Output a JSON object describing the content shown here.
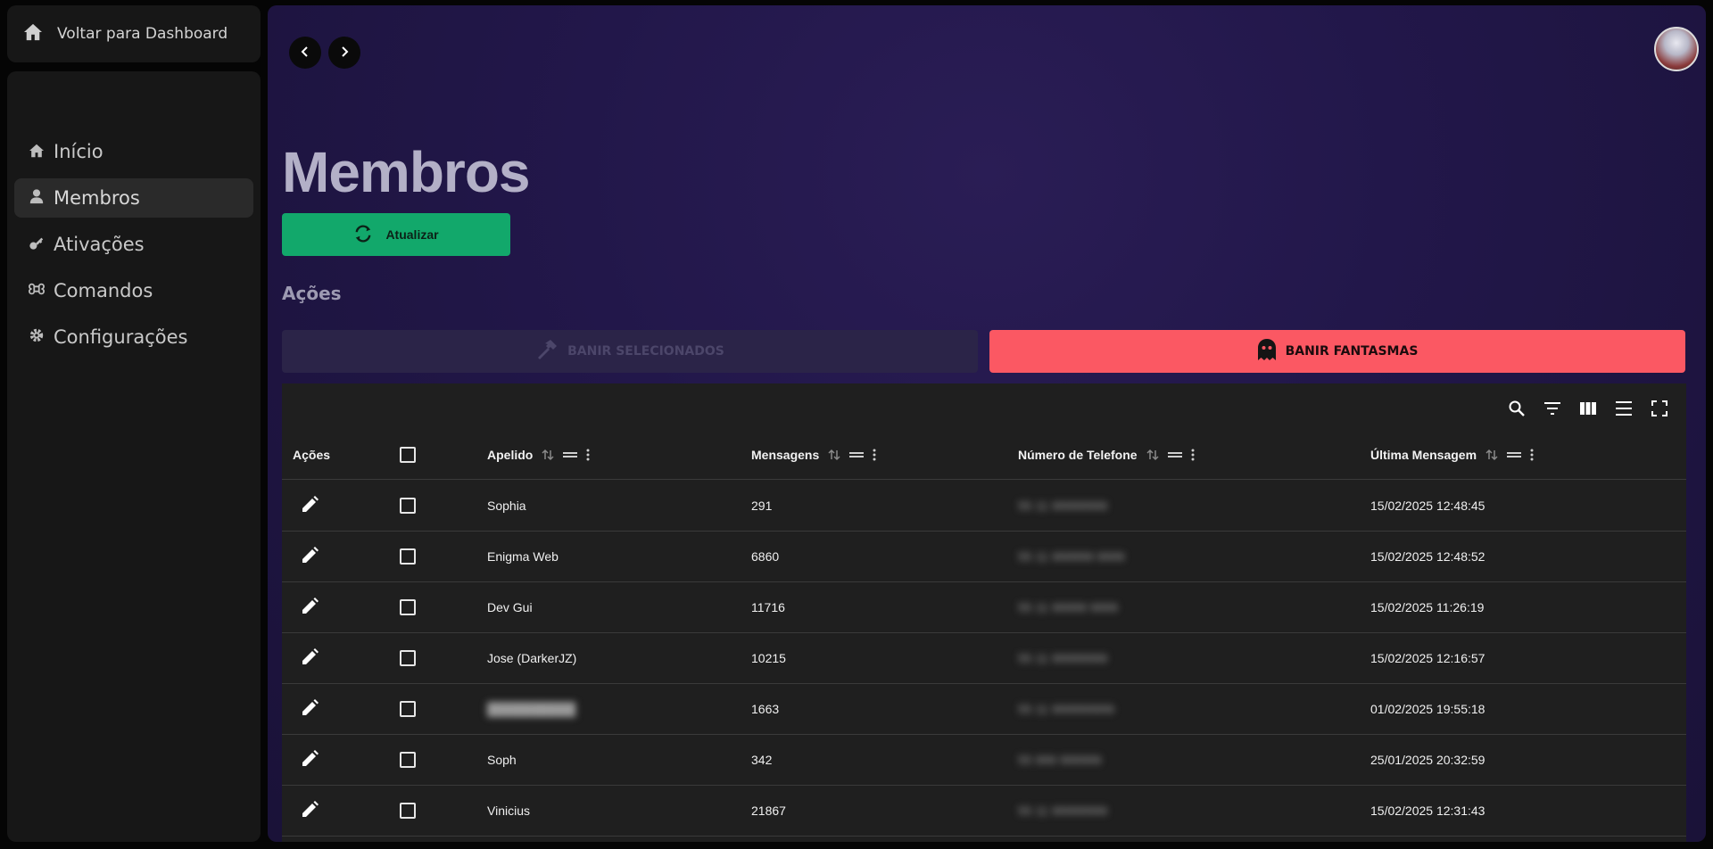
{
  "sidebar": {
    "back_label": "Voltar para Dashboard",
    "items": [
      {
        "label": "Início",
        "icon": "home-icon"
      },
      {
        "label": "Membros",
        "icon": "user-icon"
      },
      {
        "label": "Ativações",
        "icon": "key-icon"
      },
      {
        "label": "Comandos",
        "icon": "command-icon"
      },
      {
        "label": "Configurações",
        "icon": "gear-icon"
      }
    ],
    "active_index": 1
  },
  "main": {
    "title": "Membros",
    "refresh_label": "Atualizar",
    "actions_title": "Ações",
    "ban_selected_label": "BANIR SELECIONADOS",
    "ban_ghosts_label": "BANIR FANTASMAS"
  },
  "table": {
    "columns": {
      "actions": "Ações",
      "nickname": "Apelido",
      "messages": "Mensagens",
      "phone": "Número de Telefone",
      "last_message": "Última Mensagem"
    },
    "rows": [
      {
        "nickname": "Sophia",
        "messages": "291",
        "phone": "55 11 99999999",
        "last_message": "15/02/2025 12:48:45"
      },
      {
        "nickname": "Enigma Web",
        "messages": "6860",
        "phone": "55 11 999999 9999",
        "last_message": "15/02/2025 12:48:52"
      },
      {
        "nickname": "Dev Gui",
        "messages": "11716",
        "phone": "55 11 99999 9999",
        "last_message": "15/02/2025 11:26:19"
      },
      {
        "nickname": "Jose (DarkerJZ)",
        "messages": "10215",
        "phone": "55 11 99999999",
        "last_message": "15/02/2025 12:16:57"
      },
      {
        "nickname": "██████████",
        "messages": "1663",
        "phone": "55 11 999999999",
        "last_message": "01/02/2025 19:55:18"
      },
      {
        "nickname": "Soph",
        "messages": "342",
        "phone": "55 999 999999",
        "last_message": "25/01/2025 20:32:59"
      },
      {
        "nickname": "Vinicius",
        "messages": "21867",
        "phone": "55 11 99999999",
        "last_message": "15/02/2025 12:31:43"
      }
    ]
  },
  "colors": {
    "refresh": "#12a86b",
    "ban_ghosts": "#fb5863",
    "ban_selected_disabled": "#2b2448"
  }
}
